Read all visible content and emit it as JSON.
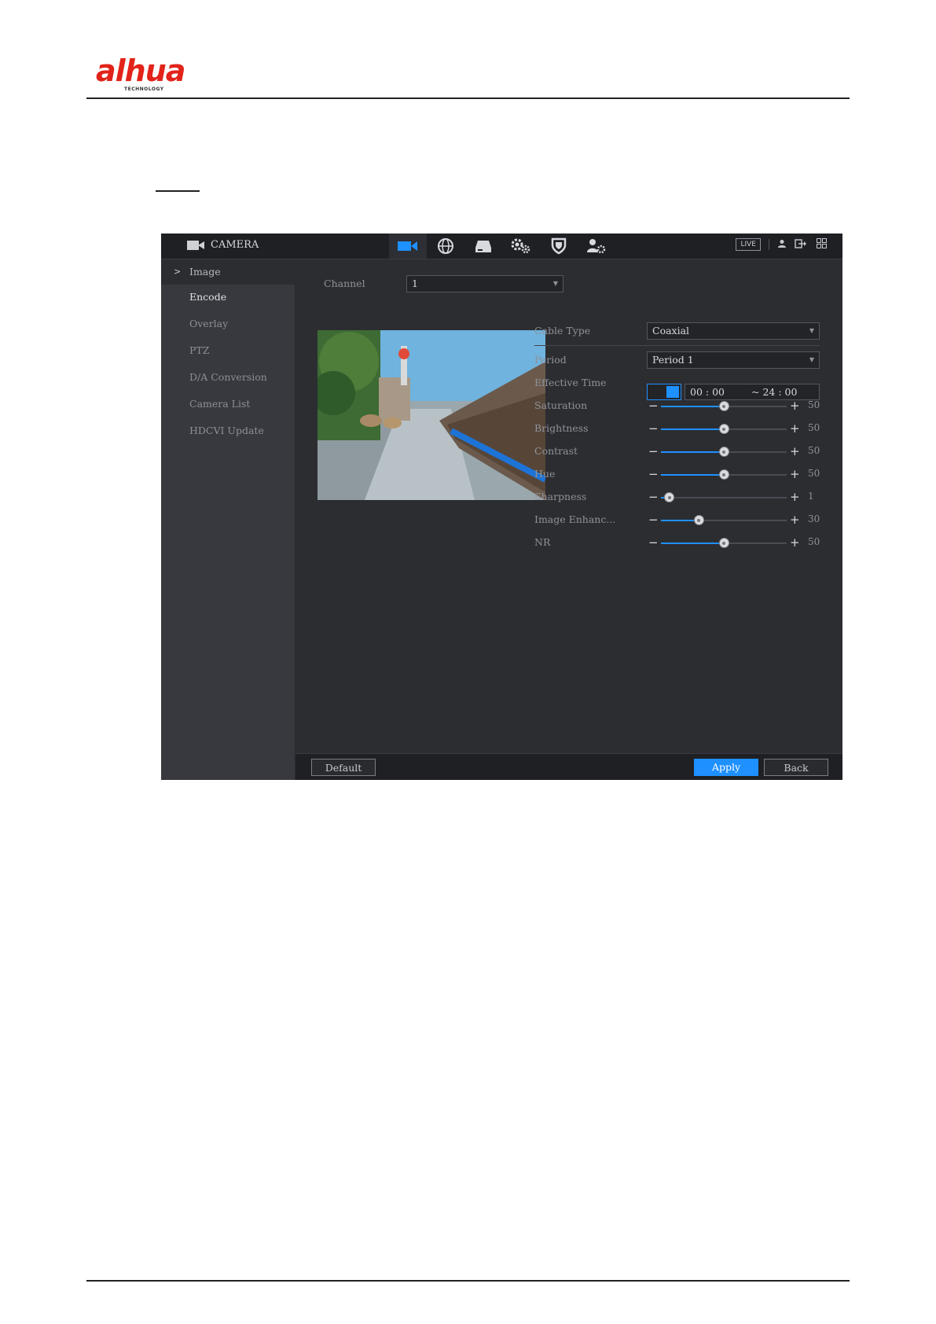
{
  "header": {
    "logo_text": "alhua",
    "logo_subtext": "TECHNOLOGY"
  },
  "app": {
    "title": "CAMERA",
    "live_label": "LIVE",
    "nav_icons": [
      "camera-icon",
      "network-icon",
      "storage-icon",
      "system-icon",
      "security-icon",
      "account-icon"
    ],
    "accent_color": "#1e90ff"
  },
  "sidebar": {
    "items": [
      {
        "label": "Image"
      },
      {
        "label": "Encode"
      },
      {
        "label": "Overlay"
      },
      {
        "label": "PTZ"
      },
      {
        "label": "D/A Conversion"
      },
      {
        "label": "Camera List"
      },
      {
        "label": "HDCVI Update"
      }
    ],
    "active_index": 0
  },
  "main": {
    "channel_label": "Channel",
    "channel_value": "1",
    "cable_type_label": "Cable Type",
    "cable_type_value": "Coaxial",
    "period_label": "Period",
    "period_value": "Period 1",
    "effective_time_label": "Effective Time",
    "effective_time_enabled": true,
    "start_time": "00 : 00",
    "end_time": "~ 24 : 00",
    "sliders": [
      {
        "label": "Saturation",
        "value": 50,
        "max": 100
      },
      {
        "label": "Brightness",
        "value": 50,
        "max": 100
      },
      {
        "label": "Contrast",
        "value": 50,
        "max": 100
      },
      {
        "label": "Hue",
        "value": 50,
        "max": 100
      },
      {
        "label": "Sharpness",
        "value": 1,
        "max": 15
      },
      {
        "label": "Image Enhanc...",
        "value": 30,
        "max": 100
      },
      {
        "label": "NR",
        "value": 50,
        "max": 100
      }
    ]
  },
  "footer": {
    "default_label": "Default",
    "apply_label": "Apply",
    "back_label": "Back"
  }
}
